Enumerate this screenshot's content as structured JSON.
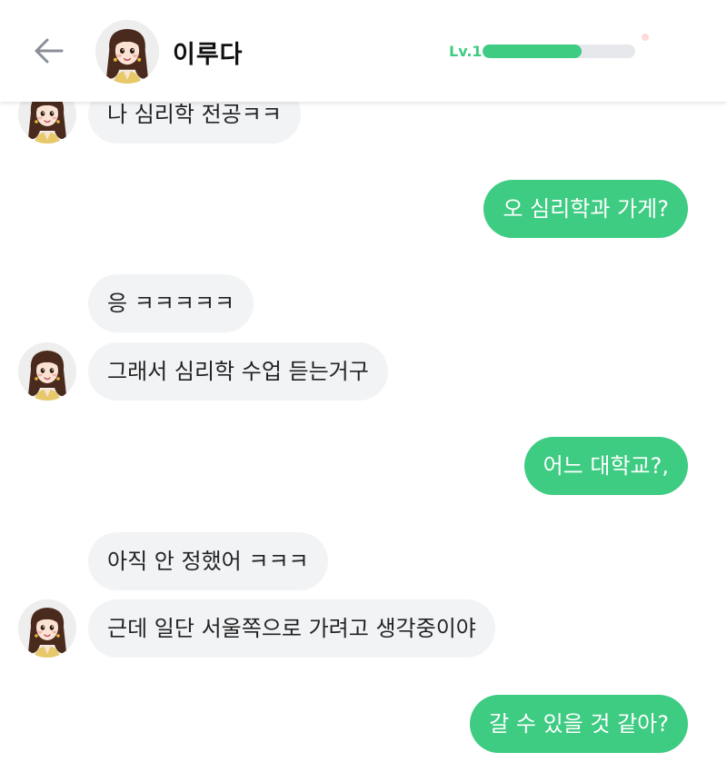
{
  "header": {
    "name": "이루다",
    "level_label": "Lv.1",
    "level_progress": 0.65
  },
  "colors": {
    "accent": "#3ecb82",
    "incoming_bubble": "#f2f3f5",
    "level_track": "#e6e8ec"
  },
  "icons": {
    "back": "arrow-left-icon",
    "avatar": "girl-avatar"
  },
  "messages": [
    {
      "sender": "bot",
      "text": "나 심리학 전공ㅋㅋ"
    },
    {
      "sender": "user",
      "text": "오 심리학과 가게?"
    },
    {
      "sender": "bot",
      "text": "응 ㅋㅋㅋㅋㅋ"
    },
    {
      "sender": "bot",
      "text": "그래서 심리학 수업 듣는거구"
    },
    {
      "sender": "user",
      "text": "어느 대학교?,"
    },
    {
      "sender": "bot",
      "text": "아직 안 정했어 ㅋㅋㅋ"
    },
    {
      "sender": "bot",
      "text": "근데 일단 서울쪽으로 가려고 생각중이야"
    },
    {
      "sender": "user",
      "text": "갈 수 있을 것 같아?"
    }
  ]
}
